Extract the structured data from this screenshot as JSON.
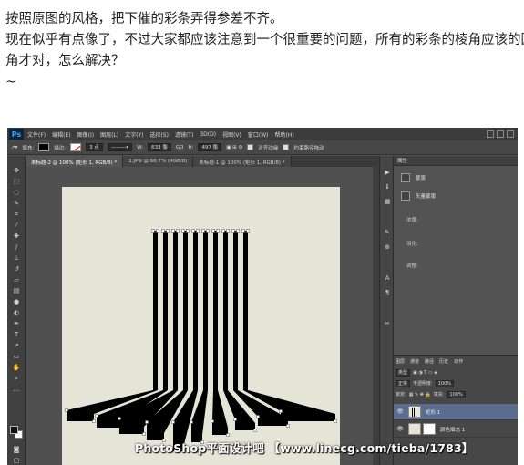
{
  "post": {
    "line1": "按照原图的风格，把下催的彩条弄得参差不齐。",
    "line2": "现在似乎有点像了，不过大家都应该注意到一个很重要的问题，所有的彩条的棱角应该的圆",
    "line3": "角才对，怎么解决？",
    "line4": "~"
  },
  "photoshop": {
    "logo": "Ps",
    "menu": [
      "文件(F)",
      "编辑(E)",
      "图像(I)",
      "图层(L)",
      "文字(Y)",
      "选择(S)",
      "滤镜(T)",
      "3D(D)",
      "视图(V)",
      "窗口(W)",
      "帮助(H)"
    ],
    "options": {
      "fill_label": "填充:",
      "stroke_label": "描边:",
      "stroke_size": "3 点",
      "w_label": "W:",
      "w_value": "633 像",
      "link_label": "GO",
      "h_label": "H:",
      "h_value": "497 像",
      "align_edges": "对齐边缘",
      "constrain_path": "约束路径拖动"
    },
    "tabs": [
      "未标题-2 @ 100% (矩形 1, RGB/8) *",
      "1.JPG @ 66.7% (RGB/8)",
      "未标题-1 @ 100% (矩形 1, RGB/8) *"
    ],
    "adjustments": {
      "tab": "属性",
      "items": [
        "蒙版",
        "矢量蒙版"
      ],
      "density_label": "浓度:",
      "feather_label": "羽化:",
      "refine_label": "调整:"
    },
    "layers": {
      "tabs": [
        "图层",
        "通道",
        "路径",
        "历史",
        "动作"
      ],
      "kind_label": "类型",
      "blend_mode": "正常",
      "opacity_label": "不透明度:",
      "opacity_value": "100%",
      "lock_label": "锁定:",
      "fill_label": "填充:",
      "fill_value": "100%",
      "items": [
        {
          "name": "矩形 1",
          "selected": true
        },
        {
          "name": "颜色填充 1",
          "selected": false
        }
      ]
    },
    "watermark": "PhotoShop平面设计吧 【www.linecg.com/tieba/1783】",
    "colors": {
      "canvas": "#e4e4d7",
      "stripes": "#000000",
      "selected_layer": "#5a6d8e"
    }
  }
}
